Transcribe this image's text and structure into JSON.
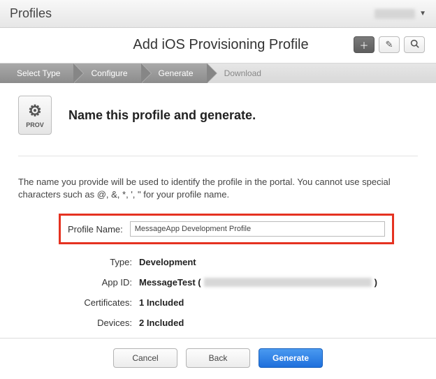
{
  "header": {
    "title": "Profiles",
    "user_label": ""
  },
  "sub_header": {
    "title": "Add iOS Provisioning Profile"
  },
  "steps": {
    "items": [
      {
        "label": "Select Type"
      },
      {
        "label": "Configure"
      },
      {
        "label": "Generate"
      },
      {
        "label": "Download"
      }
    ]
  },
  "hero": {
    "icon_caption": "PROV",
    "title": "Name this profile and generate."
  },
  "instructions": "The name you provide will be used to identify the profile in the portal. You cannot use special characters such as @, &, *, ', \" for your profile name.",
  "form": {
    "profile_name_label": "Profile Name:",
    "profile_name_value": "MessageApp Development Profile",
    "type_label": "Type:",
    "type_value": "Development",
    "appid_label": "App ID:",
    "appid_value_prefix": "MessageTest (",
    "appid_value_suffix": ")",
    "certs_label": "Certificates:",
    "certs_value": "1 Included",
    "devices_label": "Devices:",
    "devices_value": "2 Included"
  },
  "footer": {
    "cancel": "Cancel",
    "back": "Back",
    "generate": "Generate"
  }
}
